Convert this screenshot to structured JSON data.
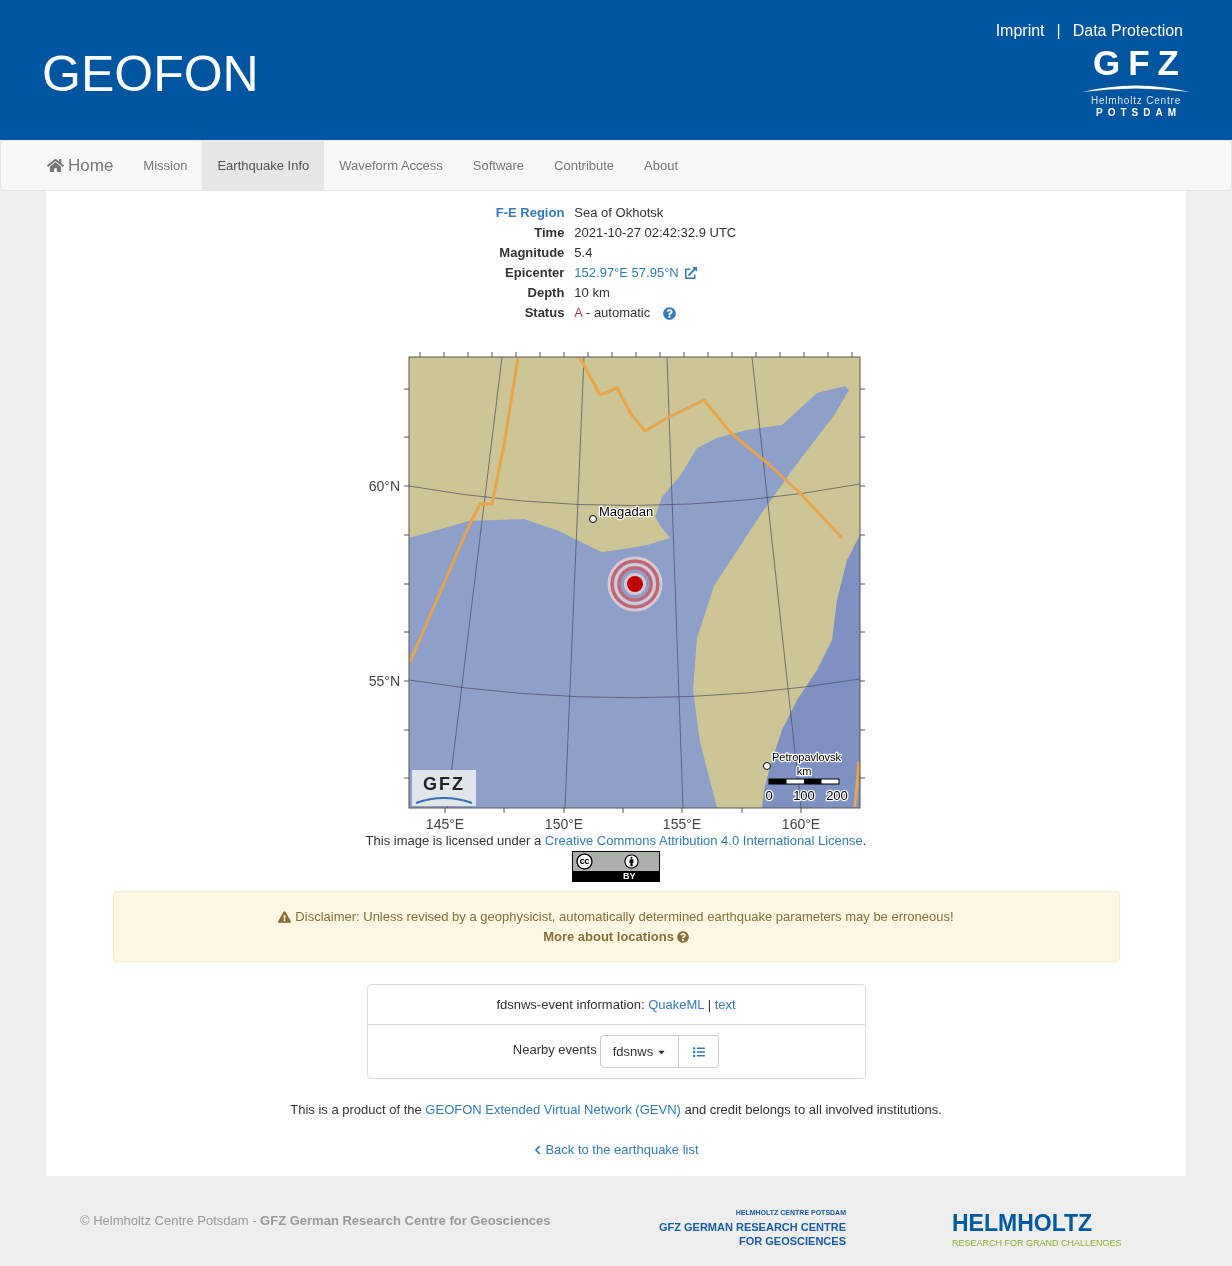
{
  "header": {
    "title": "GEOFON",
    "links": [
      "Imprint",
      "Data Protection"
    ],
    "separator": "|",
    "logo": {
      "name": "GFZ",
      "line_1": "Helmholtz Centre",
      "line_2": "POTSDAM"
    }
  },
  "nav": {
    "items": [
      {
        "label": "Home",
        "kind": "home",
        "selected": false
      },
      {
        "label": "Mission",
        "kind": "link",
        "selected": false
      },
      {
        "label": "Earthquake Info",
        "kind": "link",
        "selected": true
      },
      {
        "label": "Waveform Access",
        "kind": "link",
        "selected": false
      },
      {
        "label": "Software",
        "kind": "link",
        "selected": false
      },
      {
        "label": "Contribute",
        "kind": "link",
        "selected": false
      },
      {
        "label": "About",
        "kind": "link",
        "selected": false
      }
    ]
  },
  "event": {
    "fields": [
      {
        "label": "F-E Region",
        "label_is_link": true,
        "kind": "text",
        "value": "Sea of Okhotsk"
      },
      {
        "label": "Time",
        "label_is_link": false,
        "kind": "text",
        "value": "2021-10-27 02:42:32.9 UTC"
      },
      {
        "label": "Magnitude",
        "label_is_link": false,
        "kind": "text",
        "value": "5.4"
      },
      {
        "label": "Epicenter",
        "label_is_link": false,
        "kind": "link",
        "value": "152.97°E 57.95°N"
      },
      {
        "label": "Depth",
        "label_is_link": false,
        "kind": "text",
        "value": "10 km"
      },
      {
        "label": "Status",
        "label_is_link": false,
        "kind": "status",
        "code": "A",
        "value": "- automatic"
      }
    ]
  },
  "map": {
    "lat_labels": [
      "60°N",
      "55°N"
    ],
    "lon_labels": [
      "145°E",
      "150°E",
      "155°E",
      "160°E"
    ],
    "cities": [
      {
        "name": "Magadan"
      },
      {
        "name": "Petropavlovsk"
      }
    ],
    "scale_unit": "km",
    "scale_labels": [
      "0",
      "100",
      "200"
    ],
    "logo": "GFZ"
  },
  "license": {
    "before": "This image is licensed under a ",
    "link": "Creative Commons Attribution 4.0 International License",
    "after": ".",
    "badge_label": "BY"
  },
  "disclaimer": {
    "text": "Disclaimer: Unless revised by a geophysicist, automatically determined earthquake parameters may be erroneous!",
    "link": "More about locations"
  },
  "fdsnws": {
    "label": "fdsnws-event information:",
    "links": [
      "QuakeML",
      "text"
    ],
    "separator": "|"
  },
  "nearby": {
    "label": "Nearby events",
    "dropdown": "fdsnws"
  },
  "credit": {
    "before": "This is a product of the ",
    "link": "GEOFON Extended Virtual Network (GEVN)",
    "after": " and credit belongs to all involved institutions."
  },
  "back_link": "Back to the earthquake list",
  "footer": {
    "copyright": "© Helmholtz Centre Potsdam - **GFZ German Research Centre for Geosciences**",
    "gfz_logo": [
      "HELMHOLTZ CENTRE POTSDAM",
      "GFZ GERMAN RESEARCH CENTRE",
      "FOR GEOSCIENCES"
    ],
    "helmholtz_logo": {
      "name": "HELMHOLTZ",
      "tagline": "RESEARCH FOR GRAND CHALLENGES"
    }
  }
}
